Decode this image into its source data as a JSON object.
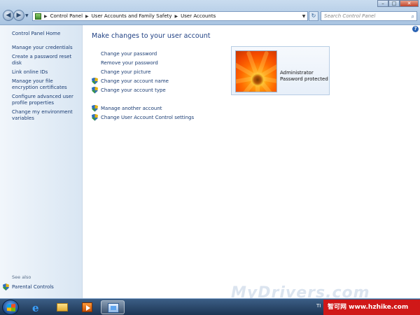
{
  "address_bar": {
    "crumbs": [
      "Control Panel",
      "User Accounts and Family Safety",
      "User Accounts"
    ],
    "search_placeholder": "Search Control Panel"
  },
  "sidebar": {
    "home": "Control Panel Home",
    "items": [
      "Manage your credentials",
      "Create a password reset disk",
      "Link online IDs",
      "Manage your file encryption certificates",
      "Configure advanced user profile properties",
      "Change my environment variables"
    ],
    "see_also": "See also",
    "parental": "Parental Controls"
  },
  "main": {
    "title": "Make changes to your user account",
    "tasks": [
      {
        "label": "Change your password",
        "shield": false
      },
      {
        "label": "Remove your password",
        "shield": false
      },
      {
        "label": "Change your picture",
        "shield": false
      },
      {
        "label": "Change your account name",
        "shield": true
      },
      {
        "label": "Change your account type",
        "shield": true
      }
    ],
    "other_tasks": [
      {
        "label": "Manage another account",
        "shield": true
      },
      {
        "label": "Change User Account Control settings",
        "shield": true
      }
    ]
  },
  "account": {
    "name": "Administrator",
    "status": "Password protected"
  },
  "taskbar": {
    "tray_text": "TI",
    "watermark": "智可网 www.hzhike.com",
    "faint_watermark": "MyDrivers.com"
  },
  "colors": {
    "link": "#1a3c73",
    "title": "#1e3f82",
    "accent_red": "#d01818"
  },
  "icons": {
    "back": "back-arrow-icon",
    "forward": "forward-arrow-icon",
    "refresh": "refresh-icon",
    "search": "search-icon",
    "help": "help-icon",
    "shield": "uac-shield-icon"
  }
}
